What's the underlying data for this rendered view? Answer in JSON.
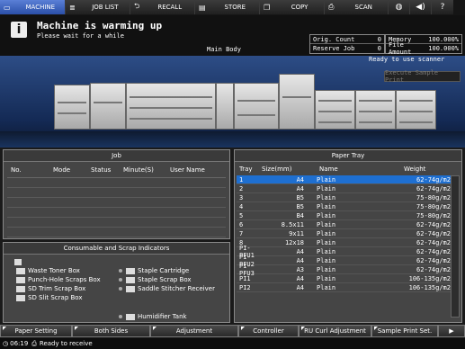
{
  "nav": {
    "tabs": [
      {
        "label": "MACHINE",
        "icon": "machine-icon"
      },
      {
        "label": "JOB LIST",
        "icon": "list-icon"
      },
      {
        "label": "RECALL",
        "icon": "recall-icon"
      },
      {
        "label": "STORE",
        "icon": "store-icon"
      },
      {
        "label": "COPY",
        "icon": "copy-icon"
      },
      {
        "label": "SCAN",
        "icon": "scan-icon"
      }
    ],
    "icons": [
      "globe-icon",
      "speaker-icon",
      "help-icon"
    ]
  },
  "message": {
    "title": "Machine is warming up",
    "subtitle": "Please wait for a while",
    "main_body": "Main Body",
    "ready": "Ready to use scanner",
    "execute_label": "Execute Sample Print"
  },
  "status": {
    "left": [
      {
        "label": "Orig. Count",
        "value": "0"
      },
      {
        "label": "Reserve Job",
        "value": "0"
      }
    ],
    "right": [
      {
        "label": "Memory",
        "value": "100.000%"
      },
      {
        "label": "File Amount",
        "value": "100.000%"
      }
    ]
  },
  "job": {
    "title": "Job",
    "columns": [
      "No.",
      "Mode",
      "Status",
      "Minute(S)",
      "User Name"
    ]
  },
  "consumable": {
    "title": "Consumable and Scrap Indicators",
    "left": [
      "Waste Toner Box",
      "Punch-Hole Scraps Box",
      "SD Trim Scrap Box",
      "SD Slit Scrap Box"
    ],
    "right": [
      "Staple Cartridge",
      "Staple Scrap Box",
      "Saddle Stitcher Receiver"
    ],
    "humidifier": "Humidifier Tank"
  },
  "paper_tray": {
    "title": "Paper Tray",
    "columns": [
      "Tray",
      "Size(mm)",
      "Name",
      "Weight"
    ],
    "rows": [
      {
        "tray": "1",
        "size": "A4",
        "name": "Plain",
        "weight": "62-74g/m2"
      },
      {
        "tray": "2",
        "size": "A4",
        "name": "Plain",
        "weight": "62-74g/m2"
      },
      {
        "tray": "3",
        "size": "B5",
        "name": "Plain",
        "weight": "75-80g/m2"
      },
      {
        "tray": "4",
        "size": "B5",
        "name": "Plain",
        "weight": "75-80g/m2"
      },
      {
        "tray": "5",
        "size": "B4",
        "name": "Plain",
        "weight": "75-80g/m2"
      },
      {
        "tray": "6",
        "size": "8.5x11",
        "name": "Plain",
        "weight": "62-74g/m2"
      },
      {
        "tray": "7",
        "size": "9x11",
        "name": "Plain",
        "weight": "62-74g/m2"
      },
      {
        "tray": "8",
        "size": "12x18",
        "name": "Plain",
        "weight": "62-74g/m2"
      },
      {
        "tray": "PI-PFU1",
        "size": "A4",
        "name": "Plain",
        "weight": "62-74g/m2"
      },
      {
        "tray": "PI-PFU2",
        "size": "A4",
        "name": "Plain",
        "weight": "62-74g/m2"
      },
      {
        "tray": "PI-PFU3",
        "size": "A3",
        "name": "Plain",
        "weight": "62-74g/m2"
      },
      {
        "tray": "PI1",
        "size": "A4",
        "name": "Plain",
        "weight": "106-135g/m2"
      },
      {
        "tray": "PI2",
        "size": "A4",
        "name": "Plain",
        "weight": "106-135g/m2"
      }
    ]
  },
  "bottom": {
    "buttons": [
      "Paper Setting",
      "Both Sides",
      "Adjustment",
      "Controller",
      "RU Curl Adjustment",
      "Sample Print Set."
    ]
  },
  "statusbar": {
    "time": "06:19",
    "text": "Ready to receive"
  },
  "colors": {
    "accent": "#1e6fd1",
    "active_tab": "#3f66c0"
  }
}
